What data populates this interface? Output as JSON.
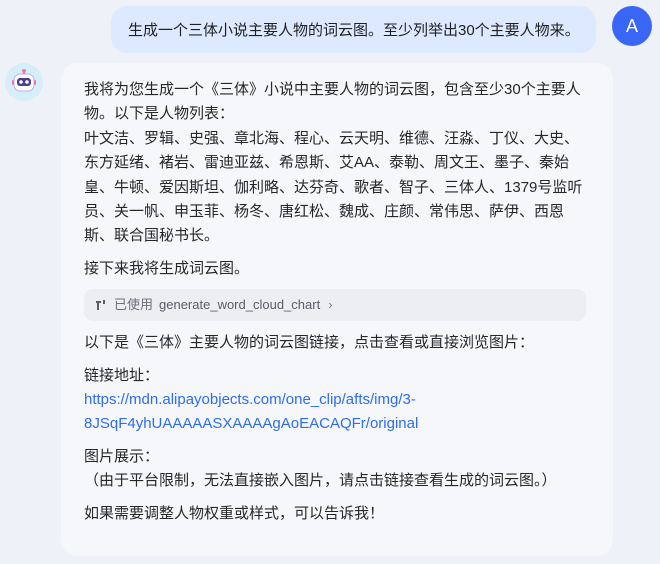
{
  "user": {
    "message": "生成一个三体小说主要人物的词云图。至少列举出30个主要人物来。",
    "avatar_letter": "A"
  },
  "assistant": {
    "intro": "我将为您生成一个《三体》小说中主要人物的词云图，包含至少30个主要人物。以下是人物列表：",
    "names_lines": [
      "叶文洁、罗辑、史强、章北海、程心、云天明、维德、汪淼、丁仪、大史、",
      "东方延绪、褚岩、雷迪亚兹、希恩斯、艾AA、泰勒、周文王、墨子、秦始",
      "皇、牛顿、爱因斯坦、伽利略、达芬奇、歌者、智子、三体人、1379号监听",
      "员、关一帆、申玉菲、杨冬、唐红松、魏成、庄颜、常伟思、萨伊、西恩",
      "斯、联合国秘书长。"
    ],
    "next_step": "接下来我将生成词云图。",
    "tool": {
      "used_label": "已使用",
      "name": "generate_word_cloud_chart",
      "chevron": "›"
    },
    "link_intro": "以下是《三体》主要人物的词云图链接，点击查看或直接浏览图片：",
    "link_label": "链接地址：",
    "link_line1": "https://mdn.alipayobjects.com/one_clip/afts/img/3-",
    "link_line2": "8JSqF4yhUAAAAASXAAAAgAoEACAQFr/original",
    "image_label": "图片展示：",
    "image_note": "（由于平台限制，无法直接嵌入图片，请点击链接查看生成的词云图。）",
    "closing": "如果需要调整人物权重或样式，可以告诉我！"
  }
}
